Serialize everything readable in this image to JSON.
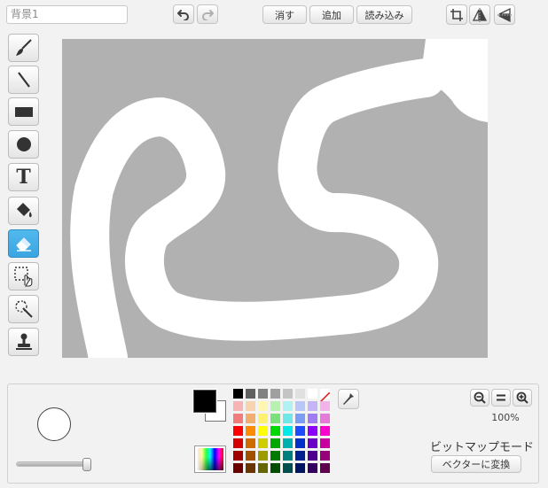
{
  "costume": {
    "name": "背景1"
  },
  "toolbar": {
    "clear_label": "消す",
    "add_label": "追加",
    "import_label": "読み込み",
    "undo_icon": "undo-icon",
    "redo_icon": "redo-icon",
    "crop_icon": "crop-icon",
    "flip_horizontal_icon": "flip-horizontal-icon",
    "flip_vertical_icon": "flip-vertical-icon"
  },
  "tools": [
    {
      "id": "brush",
      "icon": "brush-icon",
      "active": false
    },
    {
      "id": "line",
      "icon": "line-icon",
      "active": false
    },
    {
      "id": "rectangle",
      "icon": "rectangle-icon",
      "active": false
    },
    {
      "id": "ellipse",
      "icon": "ellipse-icon",
      "active": false
    },
    {
      "id": "text",
      "icon": "text-icon",
      "glyph": "T",
      "active": false
    },
    {
      "id": "fill",
      "icon": "paint-bucket-icon",
      "active": false
    },
    {
      "id": "eraser",
      "icon": "eraser-icon",
      "active": true
    },
    {
      "id": "select",
      "icon": "select-icon",
      "active": false
    },
    {
      "id": "magic-select",
      "icon": "magic-wand-icon",
      "active": false
    },
    {
      "id": "stamp",
      "icon": "stamp-icon",
      "active": false
    }
  ],
  "canvas": {
    "background_color": "#b1b1b1",
    "stroke_color": "#ffffff"
  },
  "colors": {
    "primary": "#000000",
    "secondary": "#ffffff",
    "palette": [
      [
        "#000000",
        "#606060",
        "#808080",
        "#a0a0a0",
        "#c4c4c4",
        "#e0e0e0",
        "#ffffff",
        "none"
      ],
      [
        "#f7b4b4",
        "#f7d3b0",
        "#fff7b0",
        "#b8f2b0",
        "#b0f2f2",
        "#b7c8f7",
        "#c5b4f7",
        "#f2b4e8"
      ],
      [
        "#f27c7c",
        "#f2ad71",
        "#fff170",
        "#7ae07a",
        "#70e6e6",
        "#7d9df2",
        "#9f7cf2",
        "#e67ad8"
      ],
      [
        "#ff0000",
        "#ff8c00",
        "#ffff00",
        "#00d800",
        "#00e8e8",
        "#1c4cff",
        "#8b00ff",
        "#ff00cc"
      ],
      [
        "#d40000",
        "#d06b00",
        "#cdcd00",
        "#00a800",
        "#00b0b0",
        "#0030c8",
        "#6800c8",
        "#c800a0"
      ],
      [
        "#a00000",
        "#a05000",
        "#9c9c00",
        "#007a00",
        "#007e7e",
        "#002090",
        "#4d0090",
        "#960078"
      ],
      [
        "#6a0000",
        "#6a3500",
        "#666600",
        "#004d00",
        "#004f4f",
        "#001560",
        "#330060",
        "#5e004c"
      ]
    ]
  },
  "brush": {
    "size_fraction": 0.95
  },
  "zoom": {
    "level": "100%",
    "zoom_out_icon": "zoom-out-icon",
    "zoom_reset_icon": "zoom-reset-icon",
    "zoom_in_icon": "zoom-in-icon"
  },
  "mode": {
    "label": "ビットマップモード",
    "convert_label": "ベクターに変換"
  }
}
